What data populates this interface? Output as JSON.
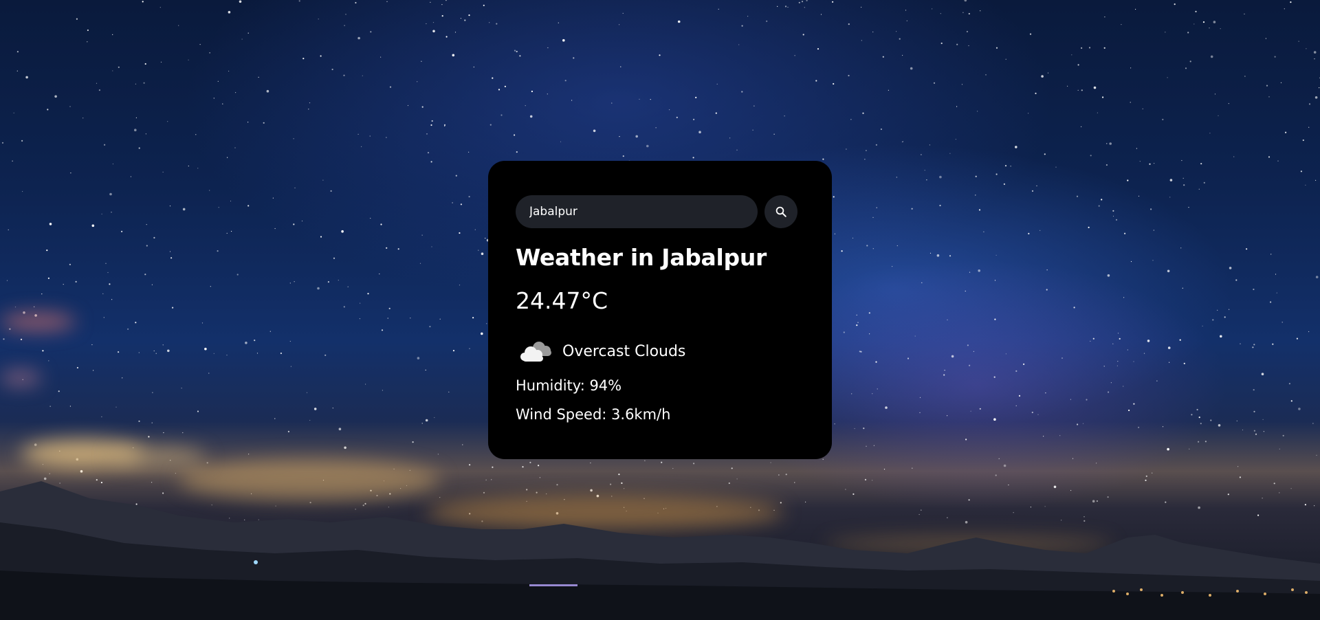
{
  "search": {
    "value": "Jabalpur",
    "icon": "search-icon"
  },
  "weather": {
    "title": "Weather in Jabalpur",
    "temperature": "24.47°C",
    "icon": "overcast-clouds-icon",
    "description": "Overcast Clouds",
    "humidity": "Humidity: 94%",
    "wind": "Wind Speed: 3.6km/h"
  },
  "colors": {
    "card_background": "#000000",
    "input_background": "#1f2229",
    "text": "#ffffff"
  }
}
